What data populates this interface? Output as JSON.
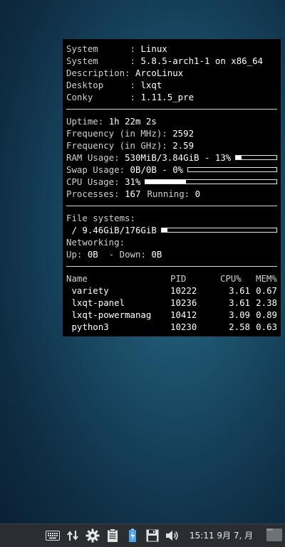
{
  "conky": {
    "system_lines": [
      {
        "label": "System      : ",
        "value": "Linux"
      },
      {
        "label": "System      : ",
        "value": "5.8.5-arch1-1 on x86_64"
      },
      {
        "label": "Description: ",
        "value": "ArcoLinux"
      },
      {
        "label": "Desktop     : ",
        "value": "lxqt"
      },
      {
        "label": "Conky       : ",
        "value": "1.11.5_pre"
      }
    ],
    "uptime_label": "Uptime: ",
    "uptime_value": "1h 22m 2s",
    "freq_mhz_label": "Frequency (in MHz): ",
    "freq_mhz_value": "2592",
    "freq_ghz_label": "Frequency (in GHz): ",
    "freq_ghz_value": "2.59",
    "ram_label": "RAM Usage: ",
    "ram_value": "530MiB/3.84GiB - 13%",
    "ram_fraction": 0.13,
    "swap_label": "Swap Usage: ",
    "swap_value": "0B/0B - 0%",
    "swap_fraction": 0.0,
    "cpu_label": "CPU Usage: ",
    "cpu_value": "31%",
    "cpu_fraction": 0.31,
    "processes_label": "Processes: ",
    "processes_value": "167",
    "running_label": "Running: ",
    "running_value": "0",
    "fs_label": "File systems:",
    "fs_value": " / 9.46GiB/176GiB",
    "fs_fraction": 0.05,
    "net_label": "Networking:",
    "up_label": "Up: ",
    "up_value": "0B",
    "down_label": "  - Down: ",
    "down_value": "0B",
    "proc_headers": {
      "name": "Name",
      "pid": "PID",
      "cpu": "CPU%",
      "mem": "MEM%"
    },
    "processes": [
      {
        "name": " variety",
        "pid": "10222",
        "cpu": "3.61",
        "mem": "0.67"
      },
      {
        "name": " lxqt-panel",
        "pid": "10236",
        "cpu": "3.61",
        "mem": "2.38"
      },
      {
        "name": " lxqt-powermanag",
        "pid": "10412",
        "cpu": "3.09",
        "mem": "0.89"
      },
      {
        "name": " python3",
        "pid": "10230",
        "cpu": "2.58",
        "mem": "0.63"
      }
    ]
  },
  "taskbar": {
    "clock": "15:11 9月 7, 月",
    "tray_icons": [
      "keyboard-icon",
      "network-transfer-icon",
      "settings-gear-icon",
      "clipboard-icon",
      "battery-icon",
      "save-disk-icon",
      "volume-icon"
    ]
  }
}
